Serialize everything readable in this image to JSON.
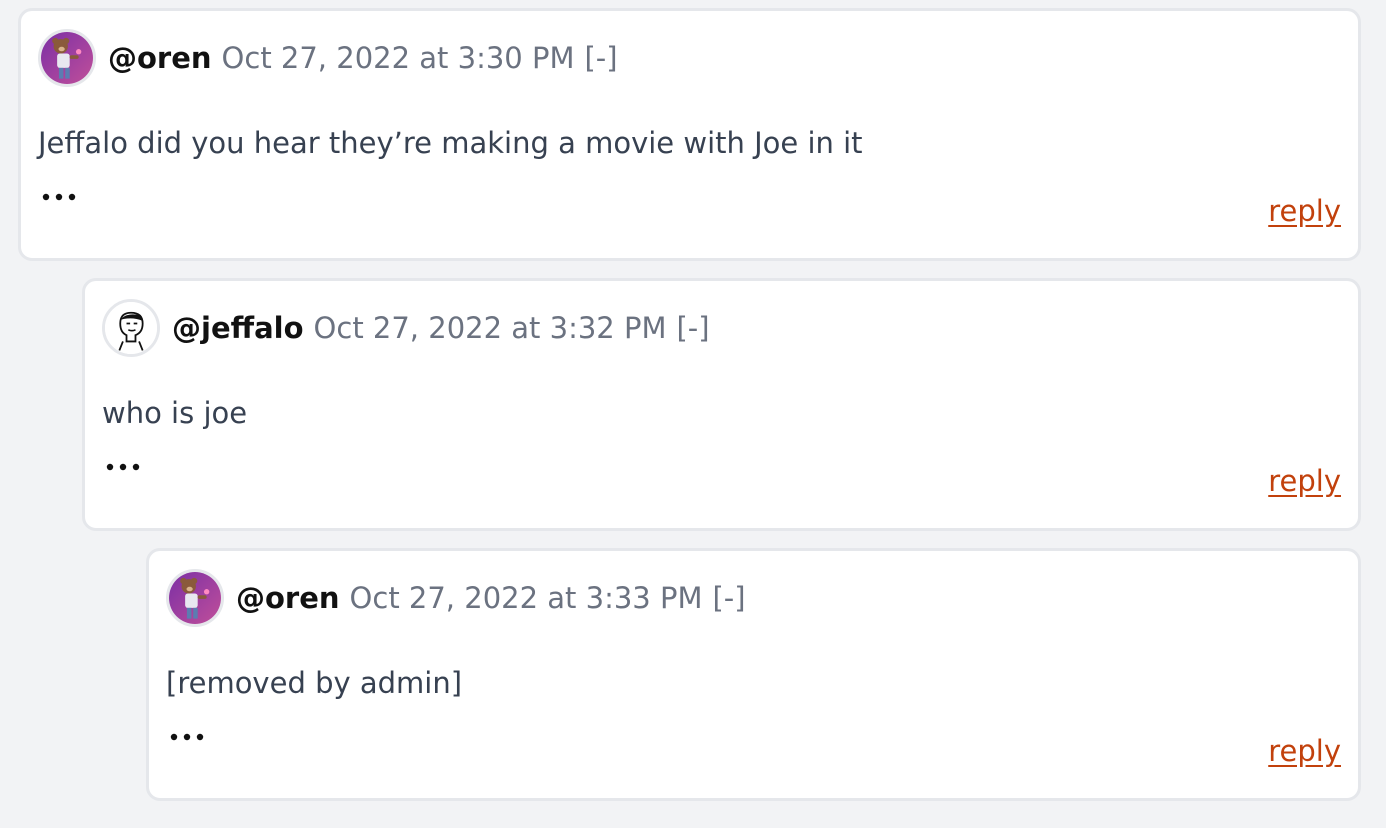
{
  "comments": [
    {
      "username": "@oren",
      "timestamp": "Oct 27, 2022 at 3:30 PM",
      "collapse_label": "[-]",
      "body": "Jeffalo did you hear they’re making a movie with Joe in it",
      "more_icon": "ellipsis-icon",
      "reply_label": "reply",
      "avatar": "bear-avatar"
    },
    {
      "username": "@jeffalo",
      "timestamp": "Oct 27, 2022 at 3:32 PM",
      "collapse_label": "[-]",
      "body": "who is joe",
      "more_icon": "ellipsis-icon",
      "reply_label": "reply",
      "avatar": "doodle-face-avatar"
    },
    {
      "username": "@oren",
      "timestamp": "Oct 27, 2022 at 3:33 PM",
      "collapse_label": "[-]",
      "body": "[removed by admin]",
      "more_icon": "ellipsis-icon",
      "reply_label": "reply",
      "avatar": "bear-avatar"
    }
  ],
  "colors": {
    "page_background": "#f2f3f5",
    "card_border": "#e5e7eb",
    "reply_link": "#c2410c",
    "timestamp": "#6b7280"
  }
}
